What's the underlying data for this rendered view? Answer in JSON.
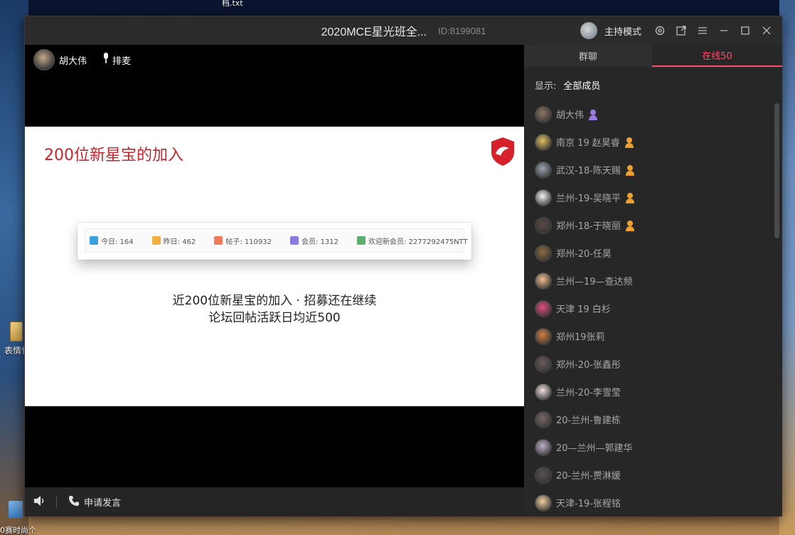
{
  "desktop": {
    "top_file": "档.txt",
    "icon1_label": "表情包",
    "icon2_label": "0赛时尚个"
  },
  "window": {
    "title": "2020MCE星光班全...",
    "room_id": "ID:8199081",
    "host_mode": "主持模式",
    "controls": [
      "settings-icon",
      "popout-icon",
      "menu-icon",
      "minimize-icon",
      "maximize-icon",
      "close-icon"
    ]
  },
  "stage": {
    "presenter_name": "胡大伟",
    "queue_label": "排麦",
    "slide": {
      "title": "200位新星宝的加入",
      "stats": [
        {
          "label": "今日: 164",
          "color": "#3aa0e0"
        },
        {
          "label": "昨日: 462",
          "color": "#f0b040"
        },
        {
          "label": "帖子: 110932",
          "color": "#f07a5a"
        },
        {
          "label": "会员: 1312",
          "color": "#8a7ae0"
        },
        {
          "label": "欢迎新会员: 2277292475NTT",
          "color": "#5ab06a"
        }
      ],
      "caption_line1": "近200位新星宝的加入 · 招募还在继续",
      "caption_line2": "论坛回帖活跃日均近500"
    },
    "apply_speak": "申请发言"
  },
  "side": {
    "tab_group": "群聊",
    "tab_online": "在线50",
    "filter_label": "显示:",
    "filter_value": "全部成员",
    "members": [
      {
        "name": "胡大伟",
        "role": "host",
        "avatar_color": "#8a7560"
      },
      {
        "name": "南京 19 赵昊睿",
        "role": "admin",
        "avatar_color": "#e0c060"
      },
      {
        "name": "武汉-18-陈天赐",
        "role": "admin",
        "avatar_color": "#9aa4b0"
      },
      {
        "name": "兰州-19-吴晓平",
        "role": "admin",
        "avatar_color": "#f2f2f2"
      },
      {
        "name": "郑州-18-于晓丽",
        "role": "admin",
        "avatar_color": "#5a4a48"
      },
      {
        "name": "郑州-20-任昊",
        "role": "",
        "avatar_color": "#8a6a40"
      },
      {
        "name": "兰州—19—查达频",
        "role": "",
        "avatar_color": "#f0c090"
      },
      {
        "name": "天津 19 白杉",
        "role": "",
        "avatar_color": "#e05080"
      },
      {
        "name": "郑州19张莉",
        "role": "",
        "avatar_color": "#d08040"
      },
      {
        "name": "郑州-20-张鑫彤",
        "role": "",
        "avatar_color": "#6a5a5a"
      },
      {
        "name": "兰州-20-李雪莹",
        "role": "",
        "avatar_color": "#f0e0e0"
      },
      {
        "name": "20-兰州-鲁建栋",
        "role": "",
        "avatar_color": "#7a6a6a"
      },
      {
        "name": "20—兰州—郭建华",
        "role": "",
        "avatar_color": "#c0b0c8"
      },
      {
        "name": "20-兰州-贾淋媛",
        "role": "",
        "avatar_color": "#5a5050"
      },
      {
        "name": "天津-19-张程铭",
        "role": "",
        "avatar_color": "#f0d0a0"
      }
    ]
  }
}
